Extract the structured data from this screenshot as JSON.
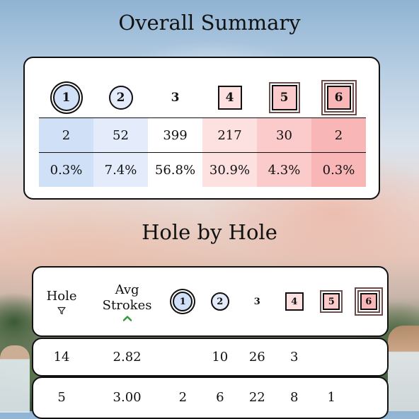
{
  "summary": {
    "title": "Overall Summary",
    "scores": [
      "1",
      "2",
      "3",
      "4",
      "5",
      "6"
    ],
    "counts": [
      "2",
      "52",
      "399",
      "217",
      "30",
      "2"
    ],
    "percents": [
      "0.3%",
      "7.4%",
      "56.8%",
      "30.9%",
      "4.3%",
      "0.3%"
    ]
  },
  "holes": {
    "title": "Hole by Hole",
    "header": {
      "hole": "Hole",
      "avg_line1": "Avg",
      "avg_line2": "Strokes"
    },
    "rows": [
      {
        "hole": "14",
        "avg": "2.82",
        "c1": "",
        "c2": "10",
        "c3": "26",
        "c4": "3",
        "c5": "",
        "c6": ""
      },
      {
        "hole": "5",
        "avg": "3.00",
        "c1": "2",
        "c2": "6",
        "c3": "22",
        "c4": "8",
        "c5": "1",
        "c6": ""
      }
    ]
  },
  "colors": {
    "eagle": "#cfe0f7",
    "birdie": "#e4ecfb",
    "par": "#ffffff",
    "bogey": "#fde0e0",
    "double": "#fbcaca",
    "triple": "#f8b6b6",
    "sort_arrow": "#2e9a3e"
  },
  "icons": {
    "filter": "filter-icon",
    "sort": "sort-up-icon"
  }
}
